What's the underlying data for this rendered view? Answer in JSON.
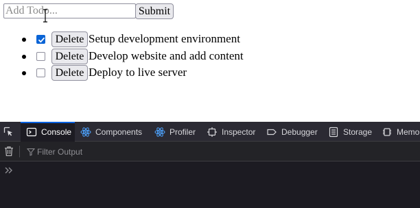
{
  "form": {
    "placeholder": "Add Todo...",
    "submit_label": "Submit"
  },
  "todos": [
    {
      "text": "Setup development environment",
      "done": true,
      "delete_label": "Delete"
    },
    {
      "text": "Develop website and add content",
      "done": false,
      "delete_label": "Delete"
    },
    {
      "text": "Deploy to live server",
      "done": false,
      "delete_label": "Delete"
    }
  ],
  "devtools": {
    "tabs": [
      {
        "label": "Console",
        "icon": "console-icon",
        "selected": true
      },
      {
        "label": "Components",
        "icon": "react-icon",
        "selected": false
      },
      {
        "label": "Profiler",
        "icon": "react-icon",
        "selected": false
      },
      {
        "label": "Inspector",
        "icon": "inspector-icon",
        "selected": false
      },
      {
        "label": "Debugger",
        "icon": "debugger-icon",
        "selected": false
      },
      {
        "label": "Storage",
        "icon": "storage-icon",
        "selected": false
      },
      {
        "label": "Memo",
        "icon": "memory-icon",
        "selected": false
      }
    ],
    "filter_placeholder": "Filter Output",
    "colors": {
      "toolbar_bg": "#2b2a33",
      "panel_bg": "#1c1b22",
      "accent": "#0060df",
      "react_blue": "#4da3ff",
      "checkbox_blue": "#0a64d6"
    }
  }
}
